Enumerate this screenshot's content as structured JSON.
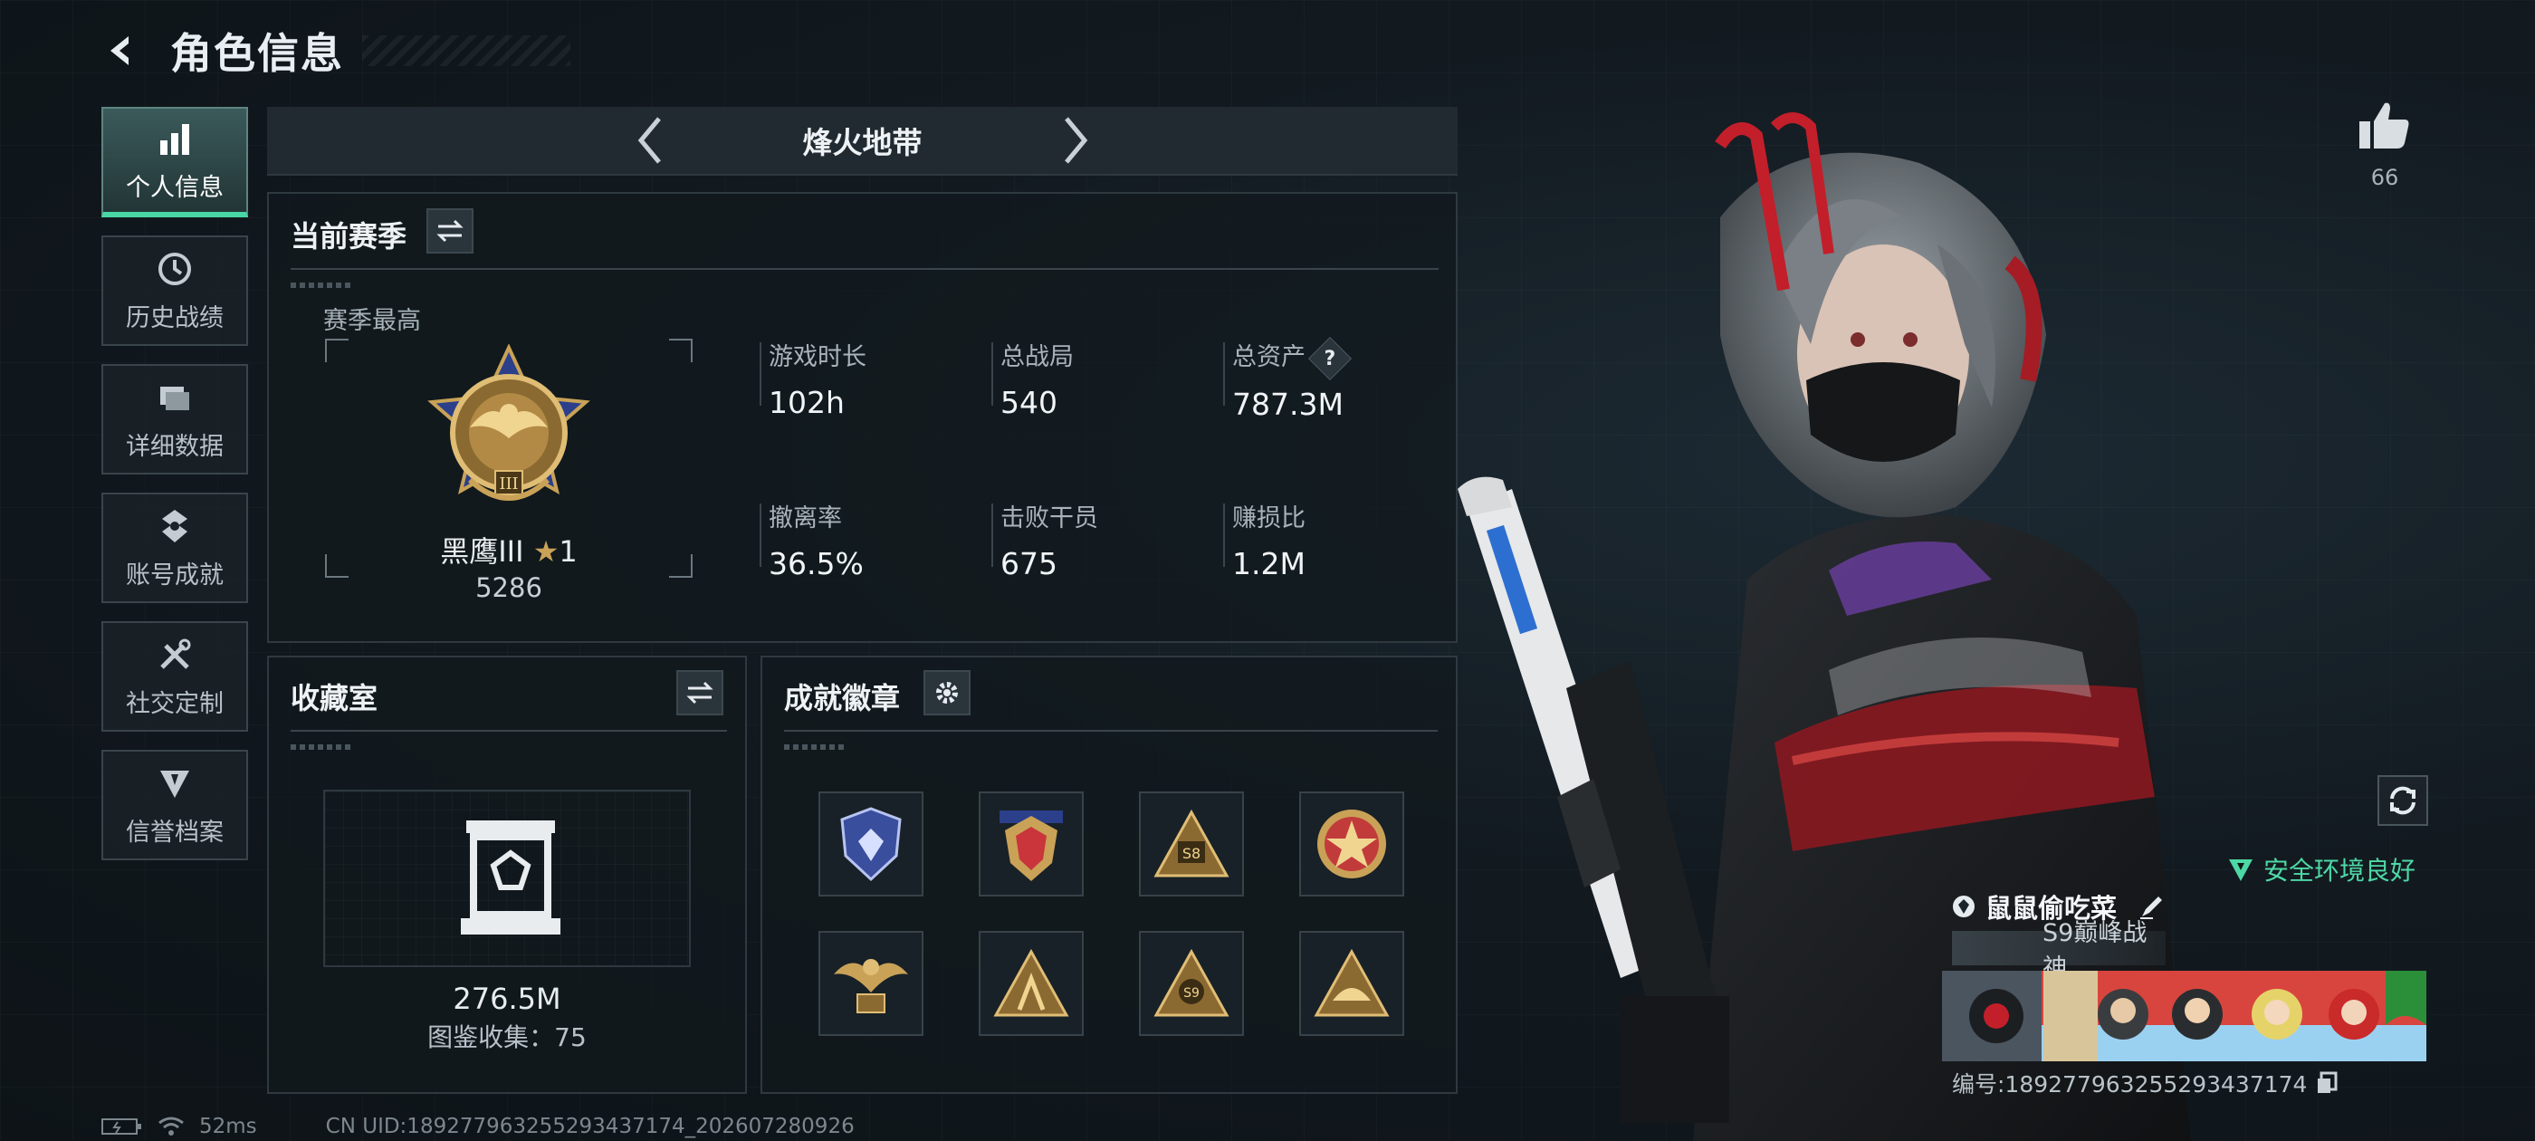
{
  "header": {
    "title": "角色信息"
  },
  "sidebar": {
    "items": [
      {
        "label": "个人信息",
        "icon": "bar-chart-icon",
        "active": true
      },
      {
        "label": "历史战绩",
        "icon": "clock-icon",
        "active": false
      },
      {
        "label": "详细数据",
        "icon": "folder-icon",
        "active": false
      },
      {
        "label": "账号成就",
        "icon": "medal-icon",
        "active": false
      },
      {
        "label": "社交定制",
        "icon": "tools-icon",
        "active": false
      },
      {
        "label": "信誉档案",
        "icon": "shield-icon",
        "active": false
      }
    ]
  },
  "mode": {
    "title": "烽火地带"
  },
  "season": {
    "title": "当前赛季",
    "subtitle": "赛季最高",
    "rank_name": "黑鹰III",
    "rank_stars": "1",
    "rank_score": "5286",
    "stats": [
      {
        "label": "游戏时长",
        "value": "102h"
      },
      {
        "label": "总战局",
        "value": "540"
      },
      {
        "label": "总资产",
        "value": "787.3M",
        "help": "?"
      },
      {
        "label": "撤离率",
        "value": "36.5%"
      },
      {
        "label": "击败干员",
        "value": "675"
      },
      {
        "label": "赚损比",
        "value": "1.2M"
      }
    ]
  },
  "collection": {
    "title": "收藏室",
    "value": "276.5M",
    "count_text": "图鉴收集：75"
  },
  "badges": {
    "title": "成就徽章",
    "items": [
      {
        "name": "shield-badge",
        "color": "#5b6fd0"
      },
      {
        "name": "red-gold-badge",
        "color": "#c9353a"
      },
      {
        "name": "s8-badge",
        "color": "#c9a257"
      },
      {
        "name": "red-star-badge",
        "color": "#c23b3b"
      },
      {
        "name": "eagle-s10-badge",
        "color": "#c9a257"
      },
      {
        "name": "gold-triangle-badge",
        "color": "#c9a257"
      },
      {
        "name": "s9-badge",
        "color": "#c9a257"
      },
      {
        "name": "gold-ship-badge",
        "color": "#c9a257"
      }
    ]
  },
  "profile": {
    "likes": "66",
    "safe_text": "安全环境良好",
    "player_name": "鼠鼠偷吃菜",
    "player_title": "S9巅峰战神",
    "player_id": "编号:1892779632552934371​74"
  },
  "status": {
    "ping": "52ms",
    "uid": "CN UID:1892779632552934371​74_202607280926"
  },
  "colors": {
    "accent": "#48d7a4",
    "gold": "#c9a257",
    "panel_border": "#2f393f"
  }
}
